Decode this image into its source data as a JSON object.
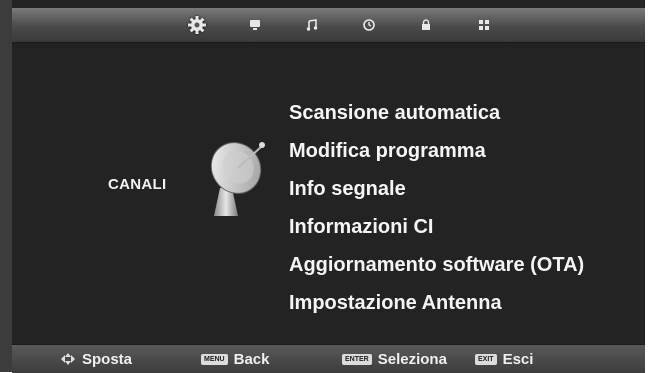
{
  "top_tabs": [
    {
      "name": "settings-gear-icon",
      "active": true
    },
    {
      "name": "tv-monitor-icon",
      "active": false
    },
    {
      "name": "music-note-icon",
      "active": false
    },
    {
      "name": "clock-icon",
      "active": false
    },
    {
      "name": "lock-icon",
      "active": false
    },
    {
      "name": "grid-icon",
      "active": false
    }
  ],
  "category": {
    "label": "CANALI",
    "icon": "satellite-dish-icon"
  },
  "menu": {
    "items": [
      "Scansione automatica",
      "Modifica programma",
      "Info segnale",
      "Informazioni CI",
      "Aggiornamento software (OTA)",
      "Impostazione Antenna"
    ]
  },
  "footer": {
    "move": {
      "icon": "direction-pad-icon",
      "label": "Sposta"
    },
    "back": {
      "key": "MENU",
      "label": "Back"
    },
    "select": {
      "key": "ENTER",
      "label": "Seleziona"
    },
    "exit": {
      "key": "EXIT",
      "label": "Esci"
    }
  },
  "colors": {
    "background": "#232323",
    "bar": "#4a4a4a",
    "text": "#f5f5f5"
  }
}
